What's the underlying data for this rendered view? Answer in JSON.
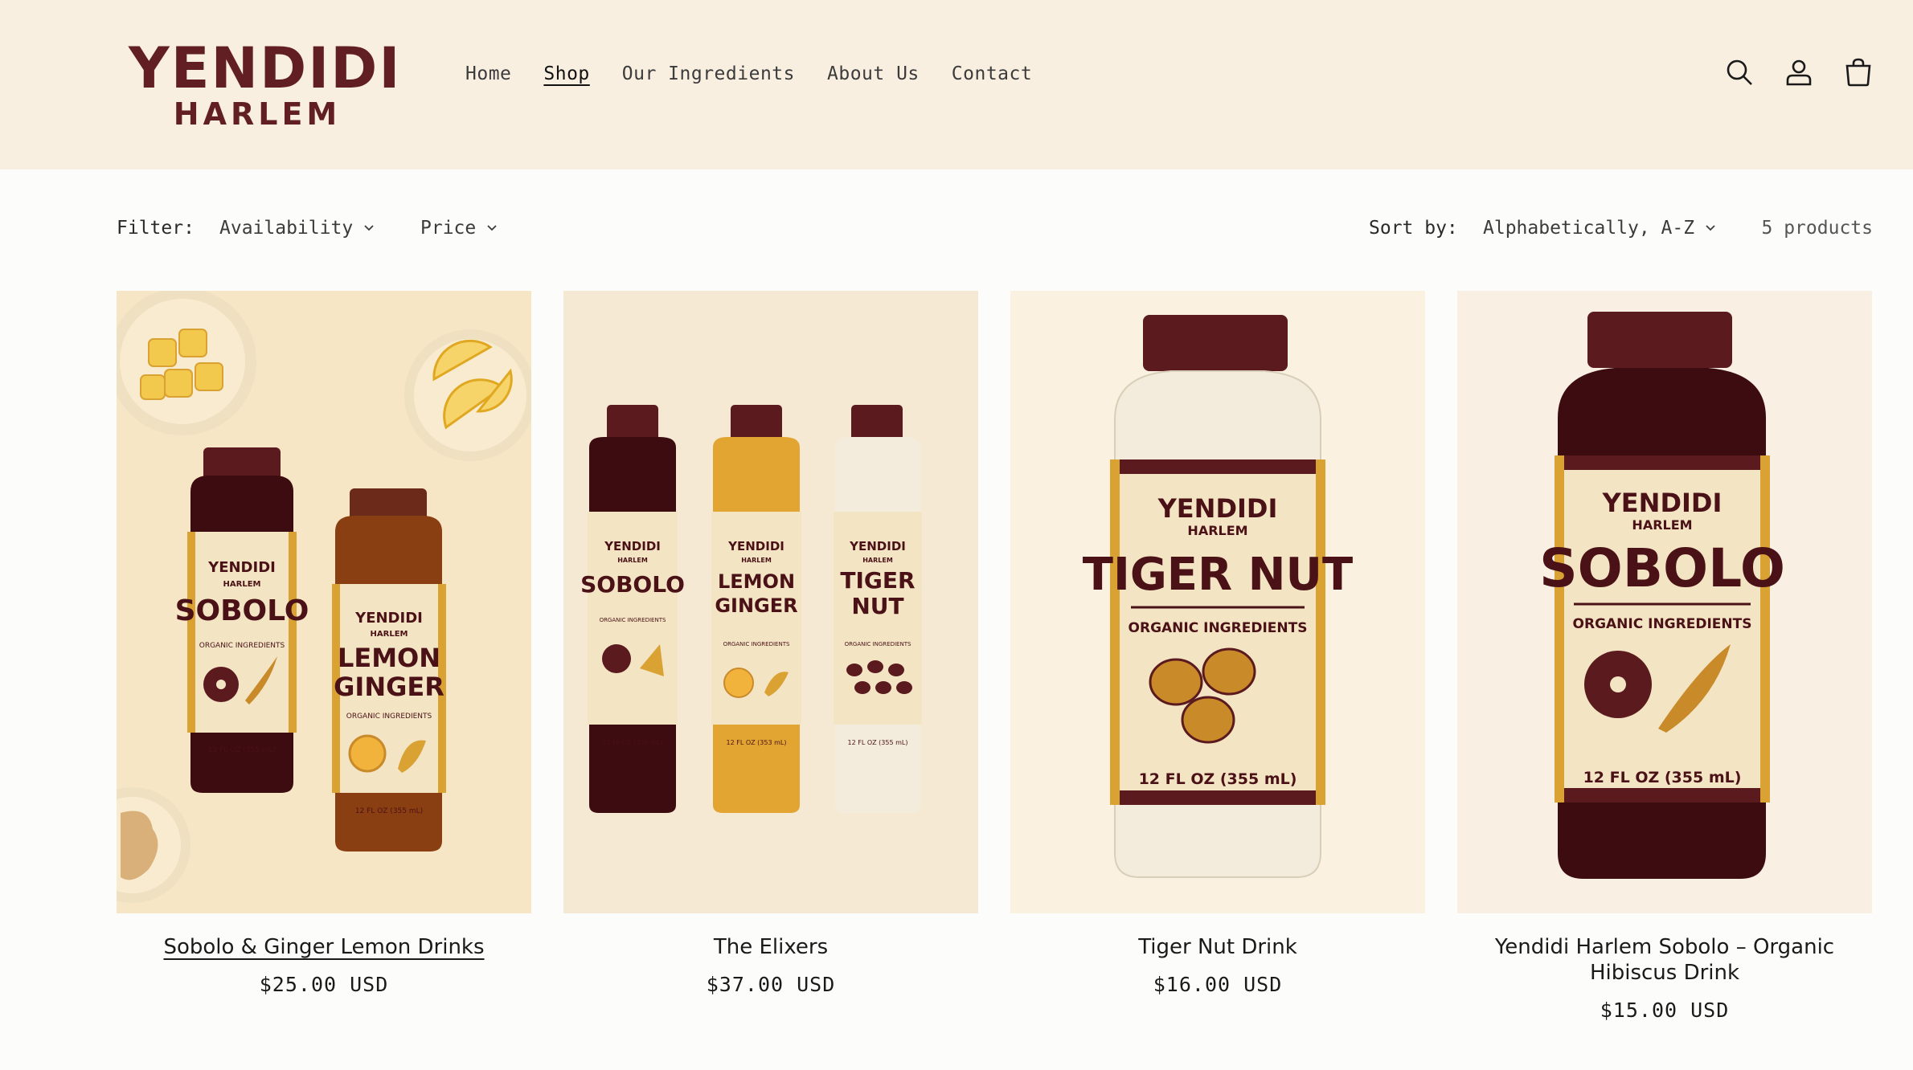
{
  "brand": {
    "line1": "YENDIDI",
    "line2": "HARLEM",
    "color": "#611f24"
  },
  "nav": [
    {
      "label": "Home"
    },
    {
      "label": "Shop",
      "active": true
    },
    {
      "label": "Our Ingredients"
    },
    {
      "label": "About Us"
    },
    {
      "label": "Contact"
    }
  ],
  "header_icons": [
    "search-icon",
    "account-icon",
    "cart-icon"
  ],
  "filters": {
    "label": "Filter:",
    "availability": "Availability",
    "price": "Price",
    "sort_label": "Sort by:",
    "sort_value": "Alphabetically, A-Z",
    "count": "5 products"
  },
  "products": [
    {
      "title": "Sobolo & Ginger Lemon Drinks",
      "price": "$25.00 USD"
    },
    {
      "title": "The Elixers",
      "price": "$37.00 USD"
    },
    {
      "title": "Tiger Nut Drink",
      "price": "$16.00 USD"
    },
    {
      "title": "Yendidi Harlem Sobolo – Organic Hibiscus Drink",
      "price": "$15.00 USD"
    }
  ],
  "bottle_labels": {
    "brand": "YENDIDI",
    "sub": "HARLEM",
    "organic": "ORGANIC INGREDIENTS",
    "volume": "12 FL OZ (355 mL)",
    "volume_alt": "12 FL OZ (353 mL)",
    "sobolo": "SOBOLO",
    "lemon": "LEMON",
    "ginger": "GINGER",
    "tiger": "TIGER",
    "nut": "NUT",
    "tiger_nut": "TIGER NUT"
  },
  "colors": {
    "header_bg": "#f8efe1",
    "maroon": "#611f24",
    "sobolo": "#4a1116",
    "lemon_ginger": "#e7a52c",
    "tiger_nut": "#f3ecdc",
    "amber": "#8a3f12",
    "label": "#f3e4c4",
    "accent": "#d9a233"
  }
}
